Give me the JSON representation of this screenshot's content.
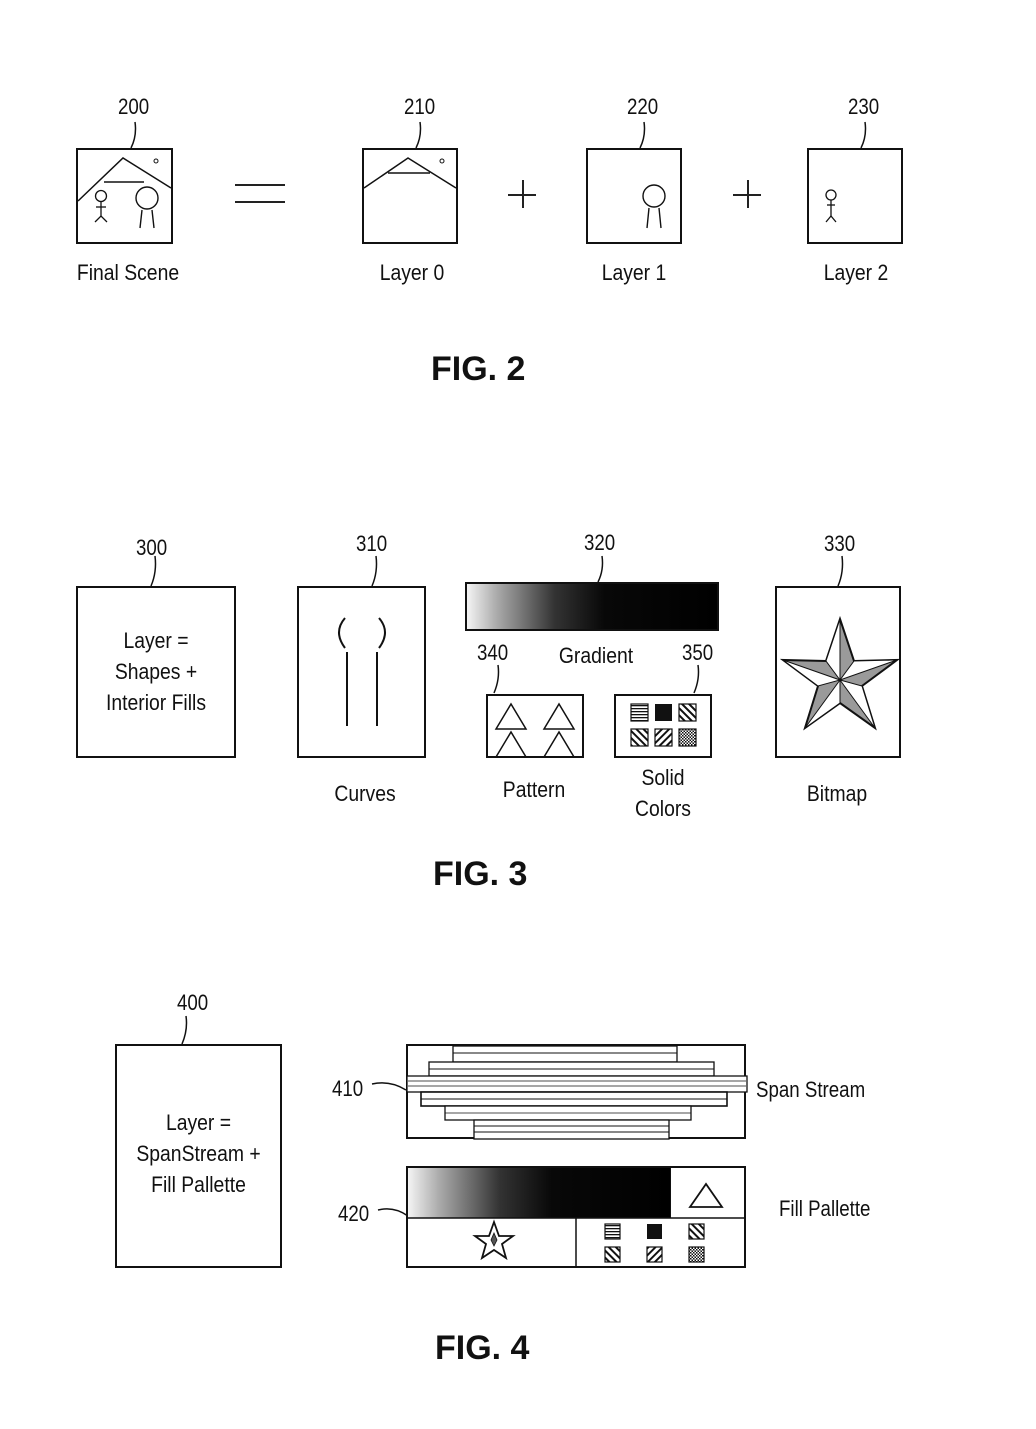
{
  "fig2": {
    "title": "FIG. 2",
    "equals": "=",
    "plus": "+",
    "panels": [
      {
        "ref": "200",
        "caption": "Final Scene",
        "contents": [
          "roof",
          "sun",
          "small-stick-figure",
          "large-figure"
        ]
      },
      {
        "ref": "210",
        "caption": "Layer 0",
        "contents": [
          "roof",
          "sun"
        ]
      },
      {
        "ref": "220",
        "caption": "Layer 1",
        "contents": [
          "large-figure"
        ]
      },
      {
        "ref": "230",
        "caption": "Layer 2",
        "contents": [
          "small-stick-figure"
        ]
      }
    ]
  },
  "fig3": {
    "title": "FIG. 3",
    "layer_box": {
      "ref": "300",
      "lines": [
        "Layer =",
        "Shapes +",
        "Interior Fills"
      ]
    },
    "curves": {
      "ref": "310",
      "caption": "Curves"
    },
    "gradient": {
      "ref": "320",
      "caption": "Gradient"
    },
    "pattern": {
      "ref": "340",
      "caption": "Pattern"
    },
    "solid_colors": {
      "ref": "350",
      "caption_lines": [
        "Solid",
        "Colors"
      ],
      "swatches": [
        "horizontal-lines",
        "solid-black",
        "diagonal-hatch",
        "diagonal-hatch-wide",
        "diagonal-hatch-reverse",
        "checker"
      ]
    },
    "bitmap": {
      "ref": "330",
      "caption": "Bitmap"
    }
  },
  "fig4": {
    "title": "FIG. 4",
    "layer_box": {
      "ref": "400",
      "lines": [
        "Layer =",
        "SpanStream +",
        "Fill Pallette"
      ]
    },
    "span_stream": {
      "ref": "410",
      "label": "Span Stream"
    },
    "fill_pallette": {
      "ref": "420",
      "label": "Fill Pallette"
    }
  }
}
